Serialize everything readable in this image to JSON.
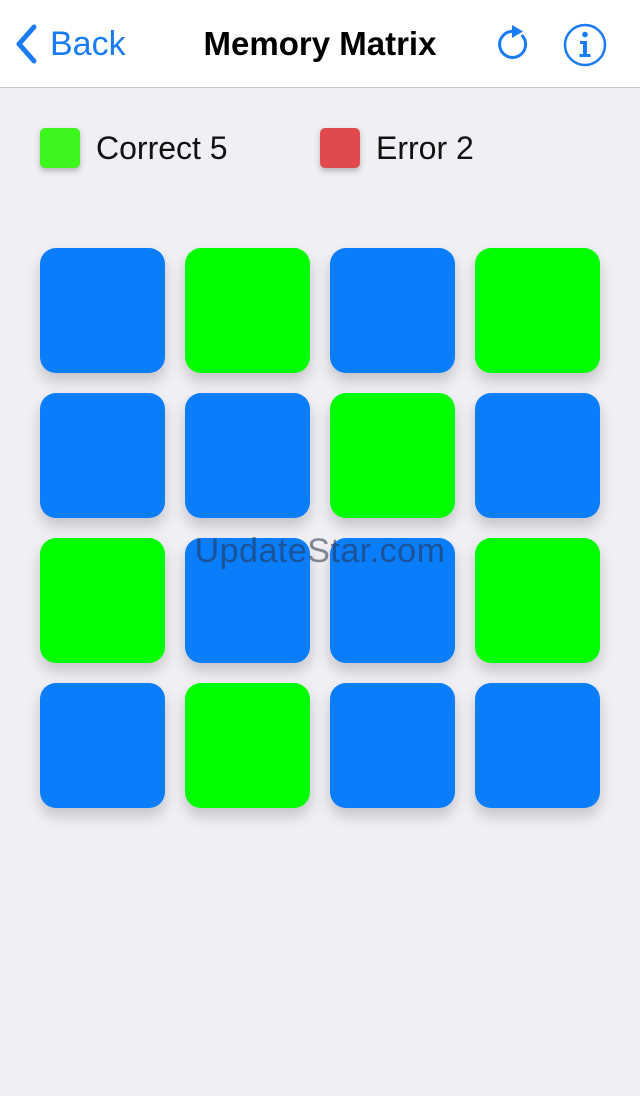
{
  "nav": {
    "back_label": "Back",
    "title": "Memory Matrix",
    "refresh_icon": "refresh-icon",
    "info_icon": "info-icon"
  },
  "legend": {
    "correct_label": "Correct 5",
    "error_label": "Error 2"
  },
  "colors": {
    "accent": "#1a7cf5",
    "tile_blue": "#0a7dfb",
    "tile_green": "#00ff00",
    "correct_swatch": "#3ef51e",
    "error_swatch": "#e04a4c"
  },
  "grid": {
    "rows": 4,
    "cols": 4,
    "tiles": [
      "blue",
      "green",
      "blue",
      "green",
      "blue",
      "blue",
      "green",
      "blue",
      "green",
      "blue",
      "blue",
      "green",
      "blue",
      "green",
      "blue",
      "blue"
    ]
  },
  "watermark": "UpdateStar.com"
}
